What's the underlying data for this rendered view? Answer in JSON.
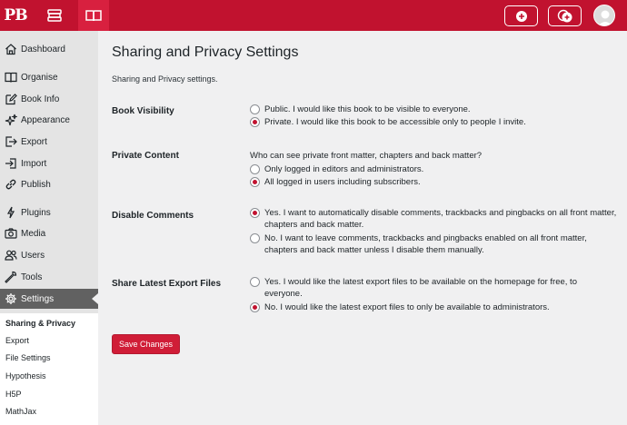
{
  "topbar": {
    "logo": "PB",
    "icons": [
      "my-books-icon",
      "book-open-icon"
    ],
    "buttons": [
      "add-book-icon",
      "clone-book-icon"
    ],
    "avatar": "user-avatar"
  },
  "sidebar": {
    "items": [
      {
        "label": "Dashboard",
        "icon": "home-icon"
      },
      {
        "label": "Organise",
        "icon": "book-icon"
      },
      {
        "label": "Book Info",
        "icon": "edit-icon"
      },
      {
        "label": "Appearance",
        "icon": "sparkle-icon"
      },
      {
        "label": "Export",
        "icon": "export-icon"
      },
      {
        "label": "Import",
        "icon": "import-icon"
      },
      {
        "label": "Publish",
        "icon": "link-icon"
      },
      {
        "label": "Plugins",
        "icon": "plug-icon"
      },
      {
        "label": "Media",
        "icon": "camera-icon"
      },
      {
        "label": "Users",
        "icon": "users-icon"
      },
      {
        "label": "Tools",
        "icon": "wrench-icon"
      },
      {
        "label": "Settings",
        "icon": "gear-icon"
      }
    ],
    "submenu": [
      "Sharing & Privacy",
      "Export",
      "File Settings",
      "Hypothesis",
      "H5P",
      "MathJax"
    ]
  },
  "main": {
    "title": "Sharing and Privacy Settings",
    "description": "Sharing and Privacy settings.",
    "sections": [
      {
        "label": "Book Visibility",
        "options": [
          {
            "text": "Public. I would like this book to be visible to everyone.",
            "checked": false
          },
          {
            "text": "Private. I would like this book to be accessible only to people I invite.",
            "checked": true
          }
        ]
      },
      {
        "label": "Private Content",
        "question": "Who can see private front matter, chapters and back matter?",
        "options": [
          {
            "text": "Only logged in editors and administrators.",
            "checked": false
          },
          {
            "text": "All logged in users including subscribers.",
            "checked": true
          }
        ]
      },
      {
        "label": "Disable Comments",
        "options": [
          {
            "text": "Yes. I want to automatically disable comments, trackbacks and pingbacks on all front matter, chapters and back matter.",
            "checked": true
          },
          {
            "text": "No. I want to leave comments, trackbacks and pingbacks enabled on all front matter, chapters and back matter unless I disable them manually.",
            "checked": false
          }
        ]
      },
      {
        "label": "Share Latest Export Files",
        "options": [
          {
            "text": "Yes. I would like the latest export files to be available on the homepage for free, to everyone.",
            "checked": false
          },
          {
            "text": "No. I would like the latest export files to only be available to administrators.",
            "checked": true
          }
        ]
      }
    ],
    "save_label": "Save Changes"
  },
  "colors": {
    "brand": "#c1122f",
    "button": "#d01d37"
  }
}
